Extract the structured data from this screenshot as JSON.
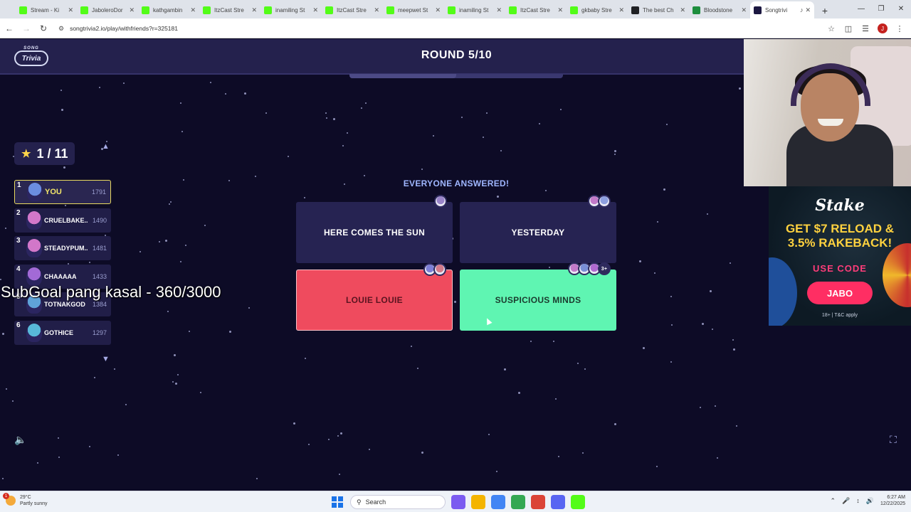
{
  "browser": {
    "tabs": [
      {
        "label": "Stream - Ki",
        "color": "#53fc18",
        "icon": "kick-icon",
        "active": false
      },
      {
        "label": "JaboleroDor",
        "color": "#53fc18",
        "icon": "kick-icon",
        "active": false
      },
      {
        "label": "kathgambin",
        "color": "#53fc18",
        "icon": "kick-icon",
        "active": false
      },
      {
        "label": "ItzCast Stre",
        "color": "#53fc18",
        "icon": "kick-icon",
        "active": false
      },
      {
        "label": "inamiling St",
        "color": "#53fc18",
        "icon": "kick-icon",
        "active": false
      },
      {
        "label": "ItzCast Stre",
        "color": "#53fc18",
        "icon": "kick-icon",
        "active": false
      },
      {
        "label": "meepwet St",
        "color": "#53fc18",
        "icon": "kick-icon",
        "active": false
      },
      {
        "label": "inamiling St",
        "color": "#53fc18",
        "icon": "kick-icon",
        "active": false
      },
      {
        "label": "ItzCast Stre",
        "color": "#53fc18",
        "icon": "kick-icon",
        "active": false
      },
      {
        "label": "gkbaby Stre",
        "color": "#53fc18",
        "icon": "kick-icon",
        "active": false
      },
      {
        "label": "The best Ch",
        "color": "#202124",
        "icon": "github-icon",
        "active": false
      },
      {
        "label": "Bloodstone",
        "color": "#1e8e3e",
        "icon": "sheets-icon",
        "active": false
      },
      {
        "label": "Songtrivi",
        "color": "#1b1740",
        "icon": "songtrivia-icon",
        "active": true
      }
    ],
    "url": "songtrivia2.io/play/withfriends?r=325181"
  },
  "game": {
    "logo_small": "SONG",
    "logo_main": "Trivia",
    "round": "ROUND 5/10",
    "progress": 0.5,
    "score": "1 / 11",
    "status": "EVERYONE ANSWERED!",
    "leaderboard": [
      {
        "rank": "1",
        "name": "YOU",
        "score": "1791",
        "avatar": "#6b8de0",
        "me": true
      },
      {
        "rank": "2",
        "name": "CRUELBAKE...",
        "score": "1490",
        "avatar": "#d277c9",
        "me": false
      },
      {
        "rank": "3",
        "name": "STEADYPUM...",
        "score": "1481",
        "avatar": "#d277c9",
        "me": false
      },
      {
        "rank": "4",
        "name": "CHAAAAA",
        "score": "1433",
        "avatar": "#a26ad6",
        "me": false
      },
      {
        "rank": "5",
        "name": "TOTNAKGOD",
        "score": "1384",
        "avatar": "#5fa3d8",
        "me": false
      },
      {
        "rank": "6",
        "name": "GOTHICE",
        "score": "1297",
        "avatar": "#58b8d8",
        "me": false
      }
    ],
    "answers": [
      {
        "label": "HERE COMES THE SUN",
        "pickers": [
          "#9a85c9"
        ],
        "more": ""
      },
      {
        "label": "YESTERDAY",
        "pickers": [
          "#c27ac9",
          "#8ea0e0"
        ],
        "more": ""
      },
      {
        "label": "LOUIE LOUIE",
        "pickers": [
          "#7d7fd6",
          "#d27a8a"
        ],
        "more": ""
      },
      {
        "label": "SUSPICIOUS MINDS",
        "pickers": [
          "#c27ac9",
          "#7a8fd6",
          "#b06ad0"
        ],
        "more": "3+"
      }
    ]
  },
  "overlay": {
    "subgoal": "SubGoal pang kasal - 360/3000"
  },
  "ad": {
    "brand": "Stake",
    "promo_line1": "GET $7 RELOAD &",
    "promo_line2": "3.5% RAKEBACK!",
    "use_code": "USE CODE",
    "code": "JABO",
    "fine_print": "18+ | T&C apply"
  },
  "taskbar": {
    "badge": "1",
    "temperature": "29°C",
    "weather": "Partly sunny",
    "search_placeholder": "Search",
    "time": "6:27 AM",
    "date": "12/22/2025",
    "apps": [
      "#7b5cf0",
      "#f4b400",
      "#4285f4",
      "#34a853",
      "#db4437",
      "#5865f2",
      "#53fc18"
    ]
  }
}
